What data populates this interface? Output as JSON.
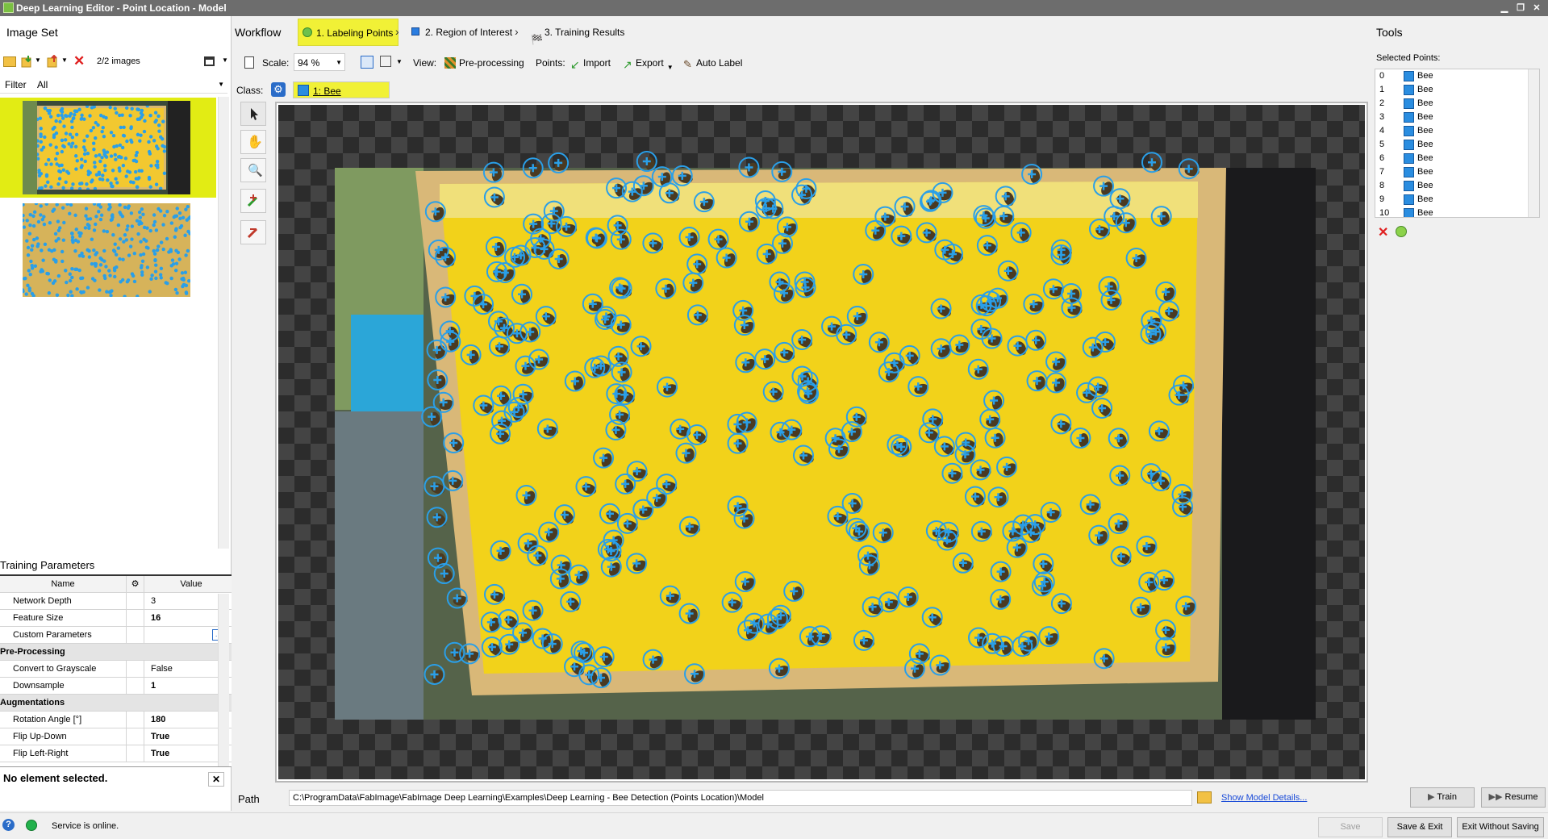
{
  "window": {
    "title": "Deep Learning Editor - Point Location - Model"
  },
  "left": {
    "image_set_title": "Image Set",
    "image_count": "2/2 images",
    "filter_label": "Filter",
    "filter_value": "All",
    "training_params_title": "Training Parameters",
    "grid_headers": {
      "name": "Name",
      "value": "Value"
    },
    "params": [
      {
        "name": "Network Depth",
        "value": "3",
        "bold": false
      },
      {
        "name": "Feature Size",
        "value": "16",
        "bold": true
      },
      {
        "name": "Custom Parameters",
        "value": "",
        "bold": false,
        "has_button": true
      }
    ],
    "cat_preprocessing": "Pre-Processing",
    "preprocessing": [
      {
        "name": "Convert to Grayscale",
        "value": "False",
        "bold": false
      },
      {
        "name": "Downsample",
        "value": "1",
        "bold": true
      }
    ],
    "cat_augmentations": "Augmentations",
    "augmentations": [
      {
        "name": "Rotation Angle [°]",
        "value": "180",
        "bold": true
      },
      {
        "name": "Flip Up-Down",
        "value": "True",
        "bold": true
      },
      {
        "name": "Flip Left-Right",
        "value": "True",
        "bold": true
      }
    ],
    "no_selection": "No element selected."
  },
  "workflow": {
    "label": "Workflow",
    "steps": [
      "1. Labeling Points",
      "2. Region of Interest",
      "3. Training Results"
    ],
    "active_step": 0
  },
  "editor_toolbar": {
    "scale_label": "Scale:",
    "scale_value": "94 %",
    "view_label": "View:",
    "preprocessing_label": "Pre-processing",
    "points_label": "Points:",
    "import_label": "Import",
    "export_label": "Export",
    "auto_label": "Auto Label"
  },
  "class_row": {
    "label": "Class:",
    "value": "1: Bee",
    "accent": "#f1f136"
  },
  "tools": {
    "title": "Tools",
    "selected_points_label": "Selected Points:",
    "points": [
      {
        "index": "0",
        "label": "Bee"
      },
      {
        "index": "1",
        "label": "Bee"
      },
      {
        "index": "2",
        "label": "Bee"
      },
      {
        "index": "3",
        "label": "Bee"
      },
      {
        "index": "4",
        "label": "Bee"
      },
      {
        "index": "5",
        "label": "Bee"
      },
      {
        "index": "6",
        "label": "Bee"
      },
      {
        "index": "7",
        "label": "Bee"
      },
      {
        "index": "8",
        "label": "Bee"
      },
      {
        "index": "9",
        "label": "Bee"
      },
      {
        "index": "10",
        "label": "Bee"
      }
    ]
  },
  "path_row": {
    "label": "Path",
    "value": "C:\\ProgramData\\FabImage\\FabImage Deep Learning\\Examples\\Deep Learning - Bee Detection (Points Location)\\Model",
    "link": "Show Model Details..."
  },
  "actions": {
    "train": "Train",
    "resume": "Resume",
    "save": "Save",
    "save_exit": "Save & Exit",
    "exit_no_save": "Exit Without Saving"
  },
  "status": {
    "text": "Service is online.",
    "color": "#22b14c"
  },
  "colors": {
    "point_marker": "#2a9fe8",
    "honeycomb": "#f2d21a",
    "frame_wood": "#d9b878"
  }
}
